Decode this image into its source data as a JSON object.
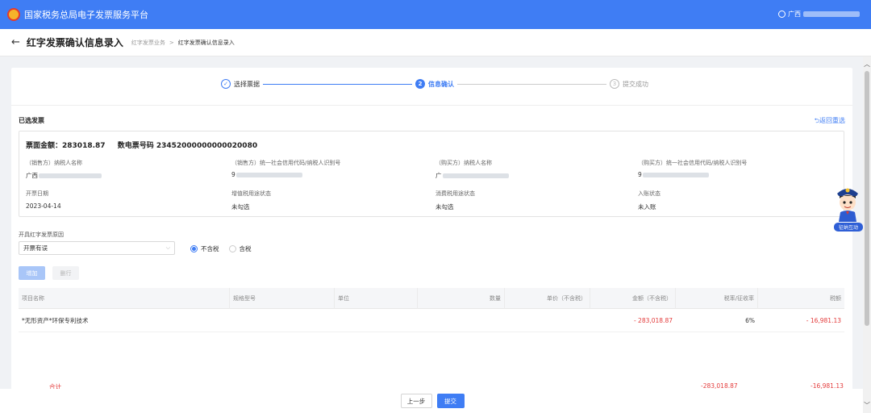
{
  "app": {
    "title": "国家税务总局电子发票服务平台",
    "user": "广西"
  },
  "header": {
    "back_icon": "arrow-left-icon",
    "title": "红字发票确认信息录入",
    "breadcrumb": [
      "红字发票业务",
      "红字发票确认信息录入"
    ],
    "breadcrumb_sep": ">"
  },
  "steps": [
    {
      "index": "✓",
      "label": "选择票据",
      "state": "done"
    },
    {
      "index": "2",
      "label": "信息确认",
      "state": "active"
    },
    {
      "index": "3",
      "label": "提交成功",
      "state": "pending"
    }
  ],
  "selected": {
    "label": "已选发票",
    "reselect": "⮌返回重选"
  },
  "invoice": {
    "amount_label": "票面金额：",
    "amount": "283018.87",
    "number_label": "数电票号码",
    "number": "23452000000000020080",
    "fields": [
      {
        "label": "（销售方）纳税人名称",
        "value": "广西"
      },
      {
        "label": "（销售方）统一社会信用代码/纳税人识别号",
        "value": "9"
      },
      {
        "label": "（购买方）纳税人名称",
        "value": "广"
      },
      {
        "label": "（购买方）统一社会信用代码/纳税人识别号",
        "value": "9"
      },
      {
        "label": "开票日期",
        "value": "2023-04-14"
      },
      {
        "label": "增值税用途状态",
        "value": "未勾选"
      },
      {
        "label": "消费税用途状态",
        "value": "未勾选"
      },
      {
        "label": "入账状态",
        "value": "未入账"
      }
    ]
  },
  "form": {
    "reason_label": "开具红字发票原因",
    "reason_value": "开票有误",
    "tax_options": [
      {
        "label": "不含税",
        "selected": true
      },
      {
        "label": "含税",
        "selected": false
      }
    ],
    "add_label": "增加",
    "delete_label": "删行"
  },
  "table": {
    "columns": [
      "项目名称",
      "规格型号",
      "单位",
      "数量",
      "单价（不含税）",
      "金额（不含税）",
      "税率/征收率",
      "税额"
    ],
    "rows": [
      {
        "name": "*无形资产*环保专利技术",
        "spec": "",
        "unit": "",
        "qty": "",
        "price": "",
        "amount": "- 283,018.87",
        "rate": "6%",
        "tax": "- 16,981.13"
      }
    ],
    "total_label": "合计",
    "total_amount": "-283,018.87",
    "total_tax": "-16,981.13"
  },
  "footer": {
    "prev_label": "上一步",
    "submit_label": "提交"
  },
  "mascot": {
    "badge": "征纳互动"
  },
  "colors": {
    "primary": "#3f7df4",
    "negative": "#e33a3a"
  }
}
